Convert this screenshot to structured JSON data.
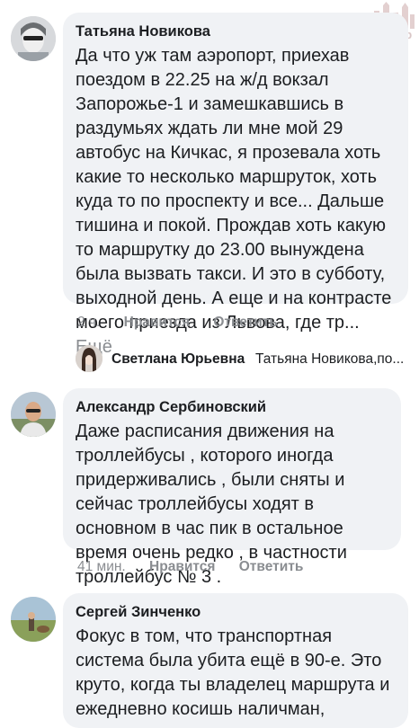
{
  "watermark": {
    "text": "ZaБор"
  },
  "comments": [
    {
      "author": "Татьяна Новикова",
      "text": "Да что уж там аэропорт, приехав поездом в 22.25 на ж/д вокзал Запорожье-1 и замешкавшись в раздумьях ждать ли мне мой 29 автобус на Кичкас, я прозевала хоть какие то несколько маршруток, хоть куда то по проспекту и все... Дальше тишина и покой. Прождав хоть какую то маршрутку до 23.00 вынуждена была вызвать такси. И это в субботу, выходной день. А еще и на контрасте моего приезда из Львова, где тр...",
      "see_more": "Ещё",
      "time": "2 ч.",
      "like": "Нравится",
      "reply": "Ответить"
    },
    {
      "author": "Александр Сербиновский",
      "text": "Даже  расписания движения на троллейбусы , которого иногда придерживались , были сняты   и сейчас троллейбусы ходят в основном в час пик в остальное время очень редко , в частности троллейбус  № 3 .",
      "time": "41 мин.",
      "like": "Нравится",
      "reply": "Ответить"
    },
    {
      "author": "Сергей Зинченко",
      "text": "Фокус в том,  что транспортная система была убита ещё в 90-е. Это круто, когда ты владелец маршрута и ежедневно косишь наличман,"
    }
  ],
  "reply_thread": {
    "name": "Светлана Юрьевна",
    "preview": "Татьяна Новикова,по..."
  },
  "colors": {
    "bubble": "#f0f2f5",
    "muted": "#8a8d91",
    "text": "#1c1e21"
  },
  "icons": [
    "avatar-tatyana",
    "avatar-svetlana",
    "avatar-aleksandr",
    "avatar-sergey",
    "watermark-castle-icon"
  ]
}
